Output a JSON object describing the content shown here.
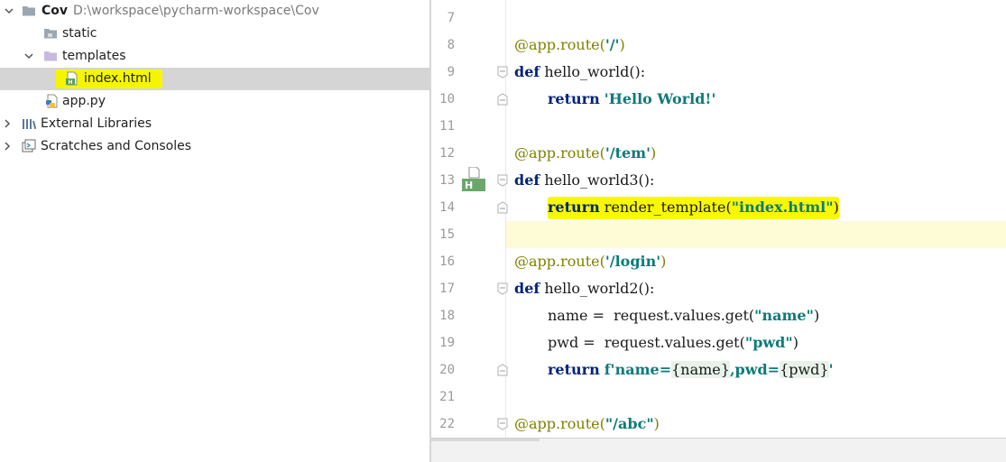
{
  "project_tree": {
    "root": {
      "name": "Cov",
      "path": "D:\\workspace\\pycharm-workspace\\Cov"
    },
    "items": [
      {
        "label": "static"
      },
      {
        "label": "templates"
      },
      {
        "label": "index.html"
      },
      {
        "label": "app.py"
      }
    ],
    "external_libraries": "External Libraries",
    "scratches": "Scratches and Consoles"
  },
  "editor": {
    "line_numbers": [
      "7",
      "8",
      "9",
      "10",
      "11",
      "12",
      "13",
      "14",
      "15",
      "16",
      "17",
      "18",
      "19",
      "20",
      "21",
      "22"
    ],
    "code": {
      "l8_dec": "@app.route(",
      "l8_str": "'/'",
      "l8_end": ")",
      "l9_kw": "def",
      "l9_fn": " hello_world():",
      "l10_kw": "return",
      "l10_str": "'Hello World!'",
      "l12_dec": "@app.route(",
      "l12_str": "'/tem'",
      "l12_end": ")",
      "l13_kw": "def",
      "l13_fn": " hello_world3():",
      "l14_kw": "return",
      "l14_fn": " render_template(",
      "l14_str": "\"index.html\"",
      "l14_end": ")",
      "l16_dec": "@app.route(",
      "l16_str": "'/login'",
      "l16_end": ")",
      "l17_kw": "def",
      "l17_fn": " hello_world2():",
      "l18_a": "name =  request.values.get(",
      "l18_str": "\"name\"",
      "l18_end": ")",
      "l19_a": "pwd =  request.values.get(",
      "l19_str": "\"pwd\"",
      "l19_end": ")",
      "l20_kw": "return",
      "l20_s1": "f'name=",
      "l20_i1": "{name}",
      "l20_s2": ",pwd=",
      "l20_i2": "{pwd}",
      "l20_s3": "'",
      "l22_dec": "@app.route(",
      "l22_str": "\"/abc\"",
      "l22_end": ")"
    },
    "template_gutter_badge": "H"
  },
  "colors": {
    "highlight": "#f5f500",
    "keyword": "#00237d",
    "string": "#0d7a7a",
    "decorator": "#808000",
    "caret_row": "#fefbd7"
  }
}
